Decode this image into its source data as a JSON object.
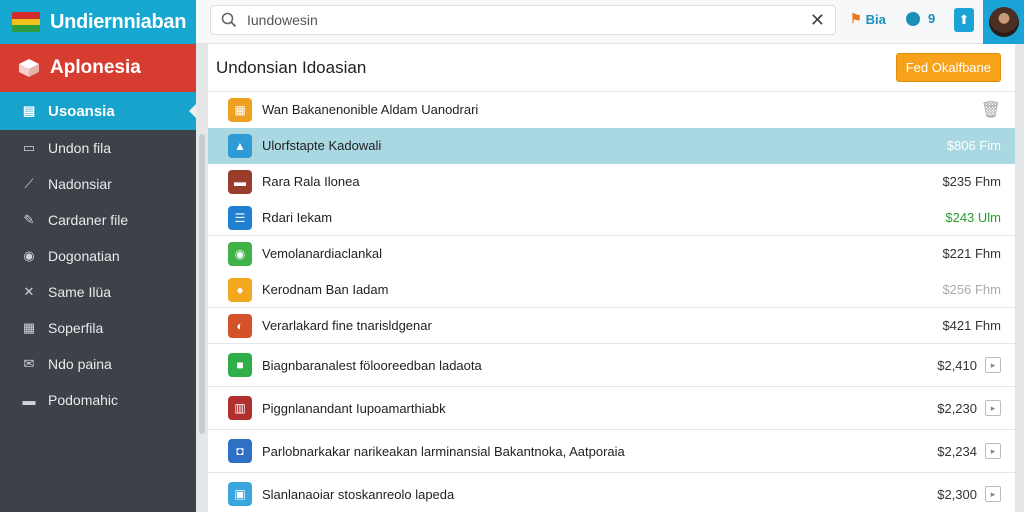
{
  "brand": {
    "title": "Undiernniaban",
    "flag_colors": [
      "#d32b2b",
      "#f2c21c",
      "#2c9c3e"
    ]
  },
  "search": {
    "value": "Iundowesin",
    "clear": "✕"
  },
  "topbar": {
    "notif_label": "Bia",
    "msg_count": "9",
    "up_glyph": "⬆"
  },
  "sidebar": {
    "header": "Aplonesia",
    "active": "Usoansia",
    "items": [
      {
        "label": "Undon fila",
        "icon": "folder-icon"
      },
      {
        "label": "Nadonsiar",
        "icon": "chart-icon"
      },
      {
        "label": "Cardaner file",
        "icon": "pencil-icon"
      },
      {
        "label": "Dogonatian",
        "icon": "eye-icon"
      },
      {
        "label": "Same Ilüa",
        "icon": "tools-icon"
      },
      {
        "label": "Soperfila",
        "icon": "grid-icon"
      },
      {
        "label": "Ndo paina",
        "icon": "mail-icon"
      },
      {
        "label": "Podomahic",
        "icon": "inbox-icon"
      }
    ]
  },
  "main": {
    "title": "Undonsian Idoasian",
    "button": "Fed Okalfbane",
    "rows": [
      {
        "name": "Wan Bakanenonible Aldam Uanodrari",
        "price": "",
        "icon_color": "#f0a020",
        "glyph": "▦",
        "trash": "🗑",
        "sel": false,
        "sep": false,
        "price_style": "",
        "action": false
      },
      {
        "name": "Ulorfstapte Kadowali",
        "price": "$806 Fim",
        "icon_color": "#2e9ad6",
        "glyph": "▲",
        "sel": true,
        "sep": false,
        "price_style": "",
        "action": false
      },
      {
        "name": "Rara Rala Ilonea",
        "price": "$235 Fhm",
        "icon_color": "#9a3d2a",
        "glyph": "▬",
        "sel": false,
        "sep": false,
        "price_style": "",
        "action": false
      },
      {
        "name": "Rdari Iekam",
        "price": "$243 Ulm",
        "icon_color": "#1f7fd0",
        "glyph": "☰",
        "sel": false,
        "sep": true,
        "price_style": "green",
        "action": false
      },
      {
        "name": "Vemolanardiaclankal",
        "price": "$221 Fhm",
        "icon_color": "#3fb24a",
        "glyph": "◉",
        "sel": false,
        "sep": false,
        "price_style": "",
        "action": false
      },
      {
        "name": "Kerodnam Ban Iadam",
        "price": "$256 Fhm",
        "icon_color": "#f2a81e",
        "glyph": "●",
        "sel": false,
        "sep": true,
        "price_style": "muted",
        "action": false
      },
      {
        "name": "Verarlakard fine tnarisldgenar",
        "price": "$421 Fhm",
        "icon_color": "#d4522a",
        "glyph": "◐",
        "sel": false,
        "sep": true,
        "price_style": "",
        "action": false
      },
      {
        "name": "Biagnbaranalest fölooreedban ladaota",
        "price": "$2,410",
        "icon_color": "#2fae4a",
        "glyph": "■",
        "sel": false,
        "sep": true,
        "price_style": "",
        "action": true
      },
      {
        "name": "Piggnlanandant Iupoamarthiabk",
        "price": "$2,230",
        "icon_color": "#b03030",
        "glyph": "▥",
        "sel": false,
        "sep": true,
        "price_style": "",
        "action": true
      },
      {
        "name": "Parlobnarkakar narikeakan larminansial Bakantnoka, Aatporaia",
        "price": "$2,234",
        "icon_color": "#2f6fc4",
        "glyph": "◘",
        "sel": false,
        "sep": true,
        "price_style": "",
        "action": true
      },
      {
        "name": "Slanlanaoiar stoskanreolo lapeda",
        "price": "$2,300",
        "icon_color": "#3aa6e0",
        "glyph": "▣",
        "sel": false,
        "sep": false,
        "price_style": "",
        "action": true
      }
    ]
  }
}
